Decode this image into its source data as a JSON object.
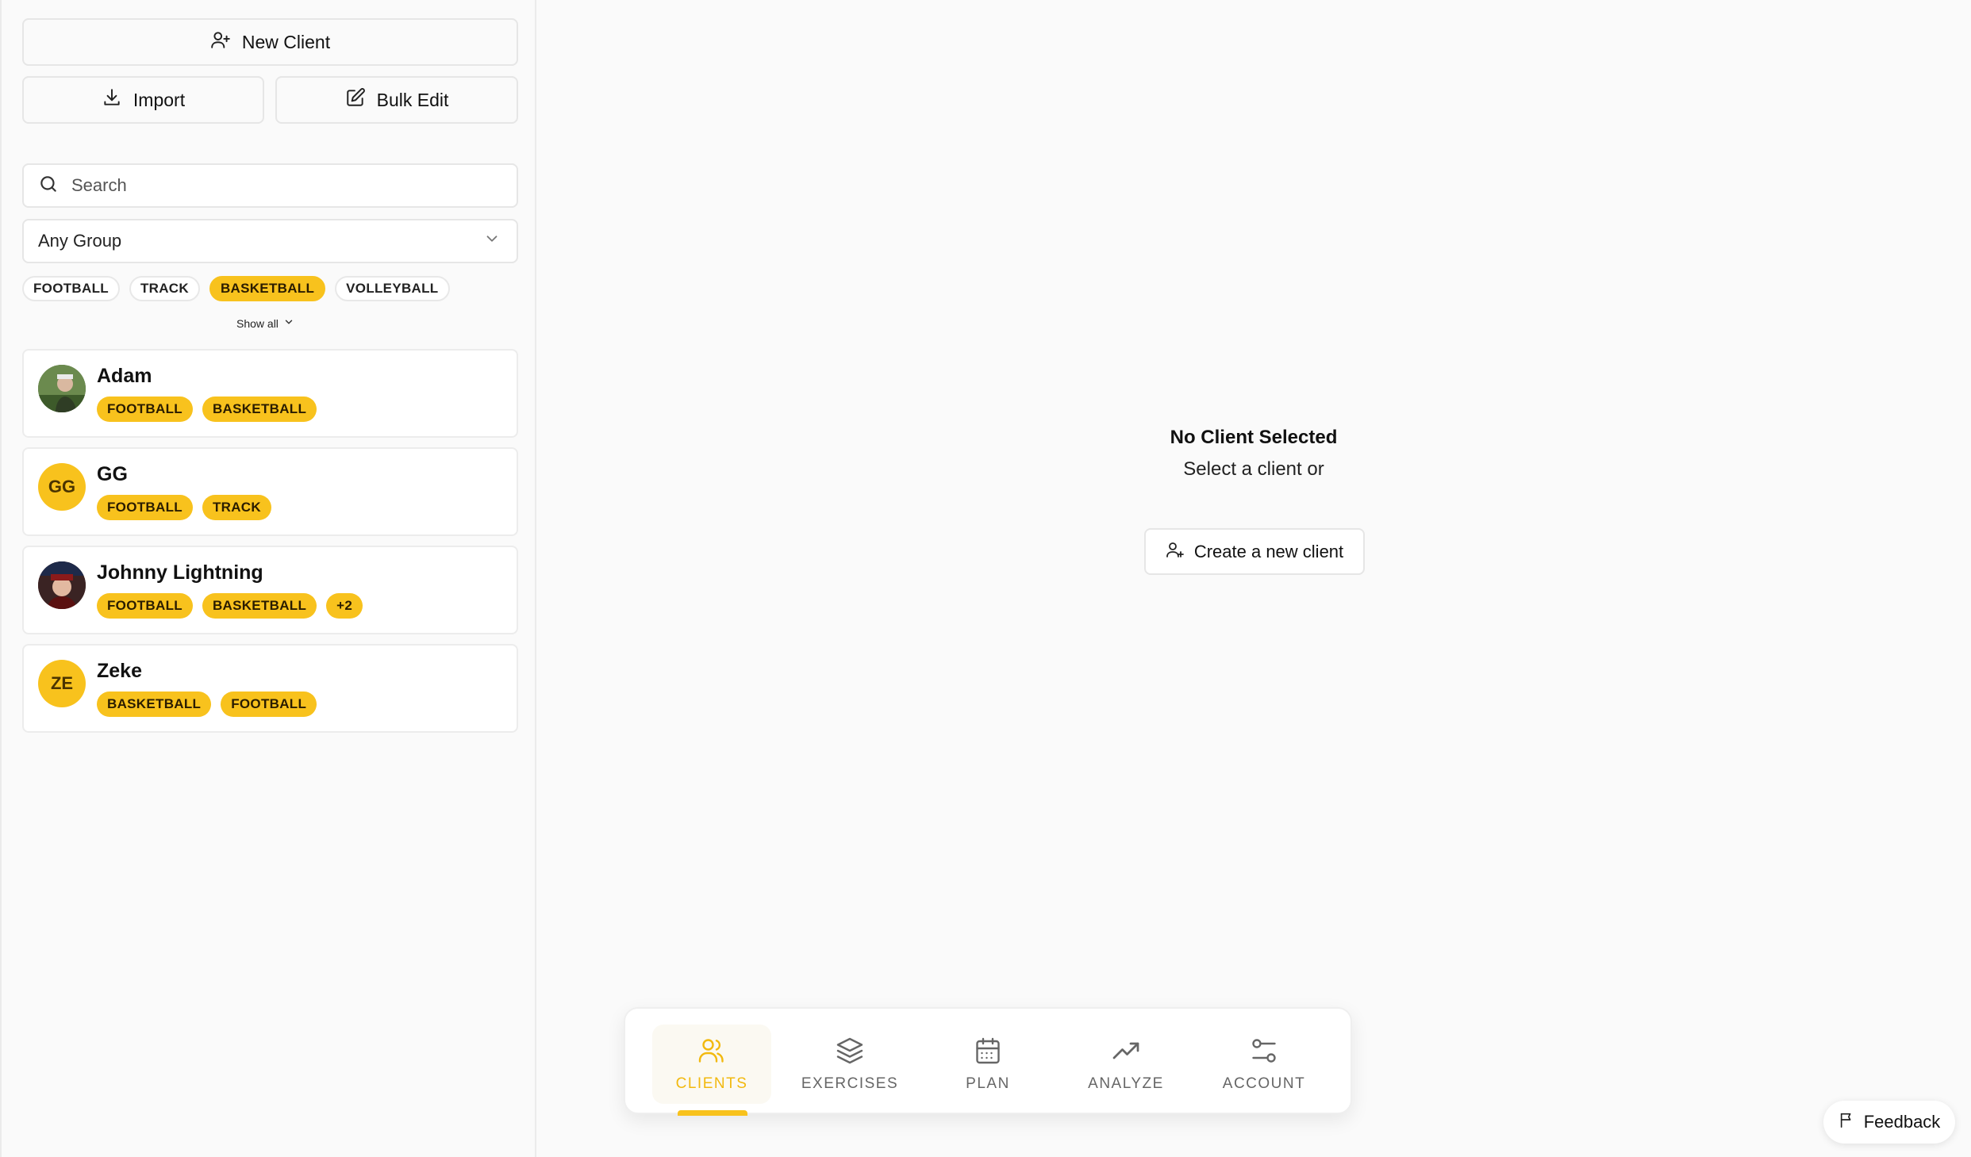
{
  "sidebar": {
    "new_client_label": "New Client",
    "import_label": "Import",
    "bulk_edit_label": "Bulk Edit",
    "search_placeholder": "Search",
    "group_select_value": "Any Group",
    "filter_chips": [
      {
        "label": "FOOTBALL",
        "active": false
      },
      {
        "label": "TRACK",
        "active": false
      },
      {
        "label": "BASKETBALL",
        "active": true
      },
      {
        "label": "VOLLEYBALL",
        "active": false
      }
    ],
    "show_all_label": "Show all",
    "clients": [
      {
        "name": "Adam",
        "initials": "",
        "avatar": "photo",
        "tags": [
          "FOOTBALL",
          "BASKETBALL"
        ]
      },
      {
        "name": "GG",
        "initials": "GG",
        "avatar": "initials",
        "tags": [
          "FOOTBALL",
          "TRACK"
        ]
      },
      {
        "name": "Johnny Lightning",
        "initials": "",
        "avatar": "photo",
        "tags": [
          "FOOTBALL",
          "BASKETBALL",
          "+2"
        ]
      },
      {
        "name": "Zeke",
        "initials": "ZE",
        "avatar": "initials",
        "tags": [
          "BASKETBALL",
          "FOOTBALL"
        ]
      }
    ]
  },
  "main": {
    "empty_title": "No Client Selected",
    "empty_subtitle": "Select a client or",
    "create_button_label": "Create a new client"
  },
  "bottom_nav": {
    "items": [
      {
        "label": "CLIENTS",
        "icon": "users-icon",
        "active": true
      },
      {
        "label": "EXERCISES",
        "icon": "layers-icon",
        "active": false
      },
      {
        "label": "PLAN",
        "icon": "calendar-icon",
        "active": false
      },
      {
        "label": "ANALYZE",
        "icon": "trending-up-icon",
        "active": false
      },
      {
        "label": "ACCOUNT",
        "icon": "sliders-icon",
        "active": false
      }
    ]
  },
  "feedback_label": "Feedback",
  "colors": {
    "accent": "#f8c21d",
    "accent_text": "#f2b90f",
    "border": "#e6e6e6",
    "background": "#fafafa"
  }
}
